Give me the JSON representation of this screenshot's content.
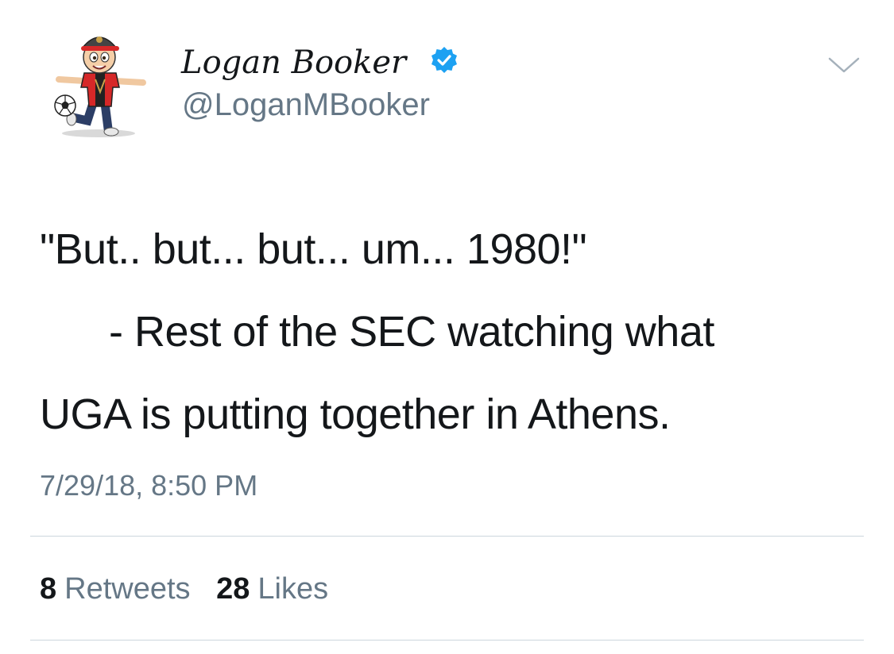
{
  "user": {
    "display_name": "Logan Booker",
    "handle": "@LoganMBooker",
    "verified": true,
    "avatar_icon": "cartoon-soccer-player-avatar"
  },
  "tweet": {
    "lines": [
      "\"But.. but... but... um... 1980!\"",
      "      - Rest of the SEC watching what",
      "UGA is putting together in Athens."
    ],
    "timestamp": "7/29/18, 8:50 PM"
  },
  "stats": {
    "retweets": {
      "count": "8",
      "label": "Retweets"
    },
    "likes": {
      "count": "28",
      "label": "Likes"
    }
  },
  "icons": {
    "verified": "verified-badge-icon",
    "menu": "chevron-down-icon"
  },
  "colors": {
    "text": "#14171a",
    "secondary": "#657786",
    "verified_blue": "#1da1f2",
    "divider": "#ccd6dd"
  }
}
